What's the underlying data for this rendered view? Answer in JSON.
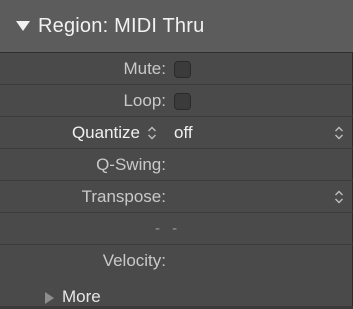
{
  "inspector": {
    "section_title": "Region: MIDI Thru",
    "rows": {
      "mute": {
        "label": "Mute:",
        "checked": false
      },
      "loop": {
        "label": "Loop:",
        "checked": false
      },
      "quantize": {
        "label": "Quantize",
        "value": "off"
      },
      "q_swing": {
        "label": "Q-Swing:"
      },
      "transpose": {
        "label": "Transpose:"
      },
      "placeholder": {
        "text": "- -"
      },
      "velocity": {
        "label": "Velocity:"
      }
    },
    "more_label": "More"
  },
  "icons": {
    "collapse": "disclosure-triangle-down-icon",
    "expand": "disclosure-triangle-right-icon",
    "stepper": "up-down-chevron-icon"
  },
  "colors": {
    "panel_bg": "#4a4a4a",
    "header_bg": "#5c5c5c",
    "text": "#f0f0f0",
    "label": "#c9c9c9"
  }
}
